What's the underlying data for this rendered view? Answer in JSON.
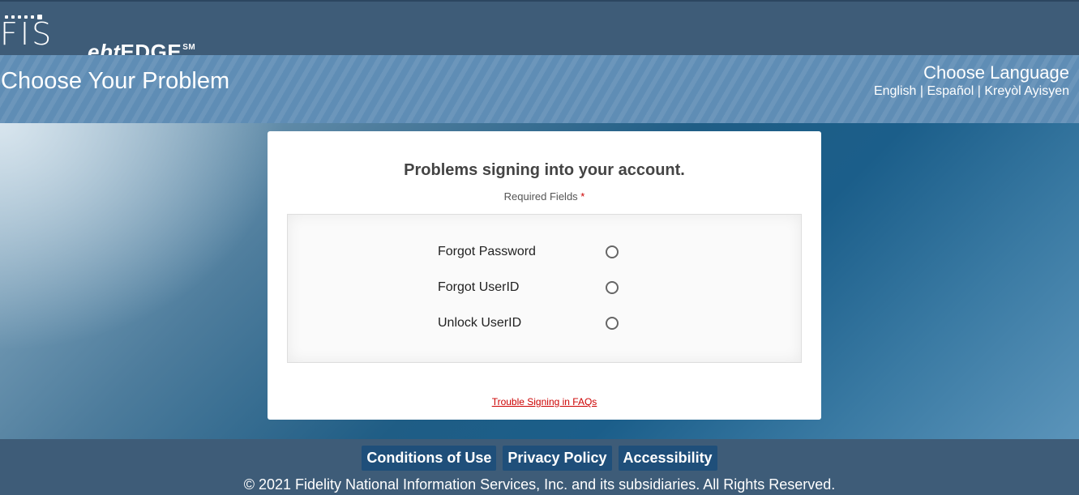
{
  "header": {
    "logo_fis": "FIS",
    "logo_ebt": "ebt",
    "logo_edge": "EDGE",
    "logo_sm": "SM"
  },
  "banner": {
    "title": "Choose Your Problem",
    "language_title": "Choose Language",
    "languages": [
      "English",
      "Español",
      "Kreyòl Ayisyen"
    ],
    "separator": " | "
  },
  "card": {
    "title": "Problems signing into your account.",
    "required_label": "Required Fields",
    "required_star": "*",
    "options": [
      {
        "label": "Forgot Password",
        "selected": false
      },
      {
        "label": "Forgot UserID",
        "selected": false
      },
      {
        "label": "Unlock UserID",
        "selected": false
      }
    ],
    "faq_link": "Trouble Signing in FAQs"
  },
  "footer": {
    "links": [
      "Conditions of Use",
      "Privacy Policy",
      "Accessibility"
    ],
    "copyright": "© 2021 Fidelity National Information Services, Inc. and its subsidiaries. All Rights Reserved."
  }
}
